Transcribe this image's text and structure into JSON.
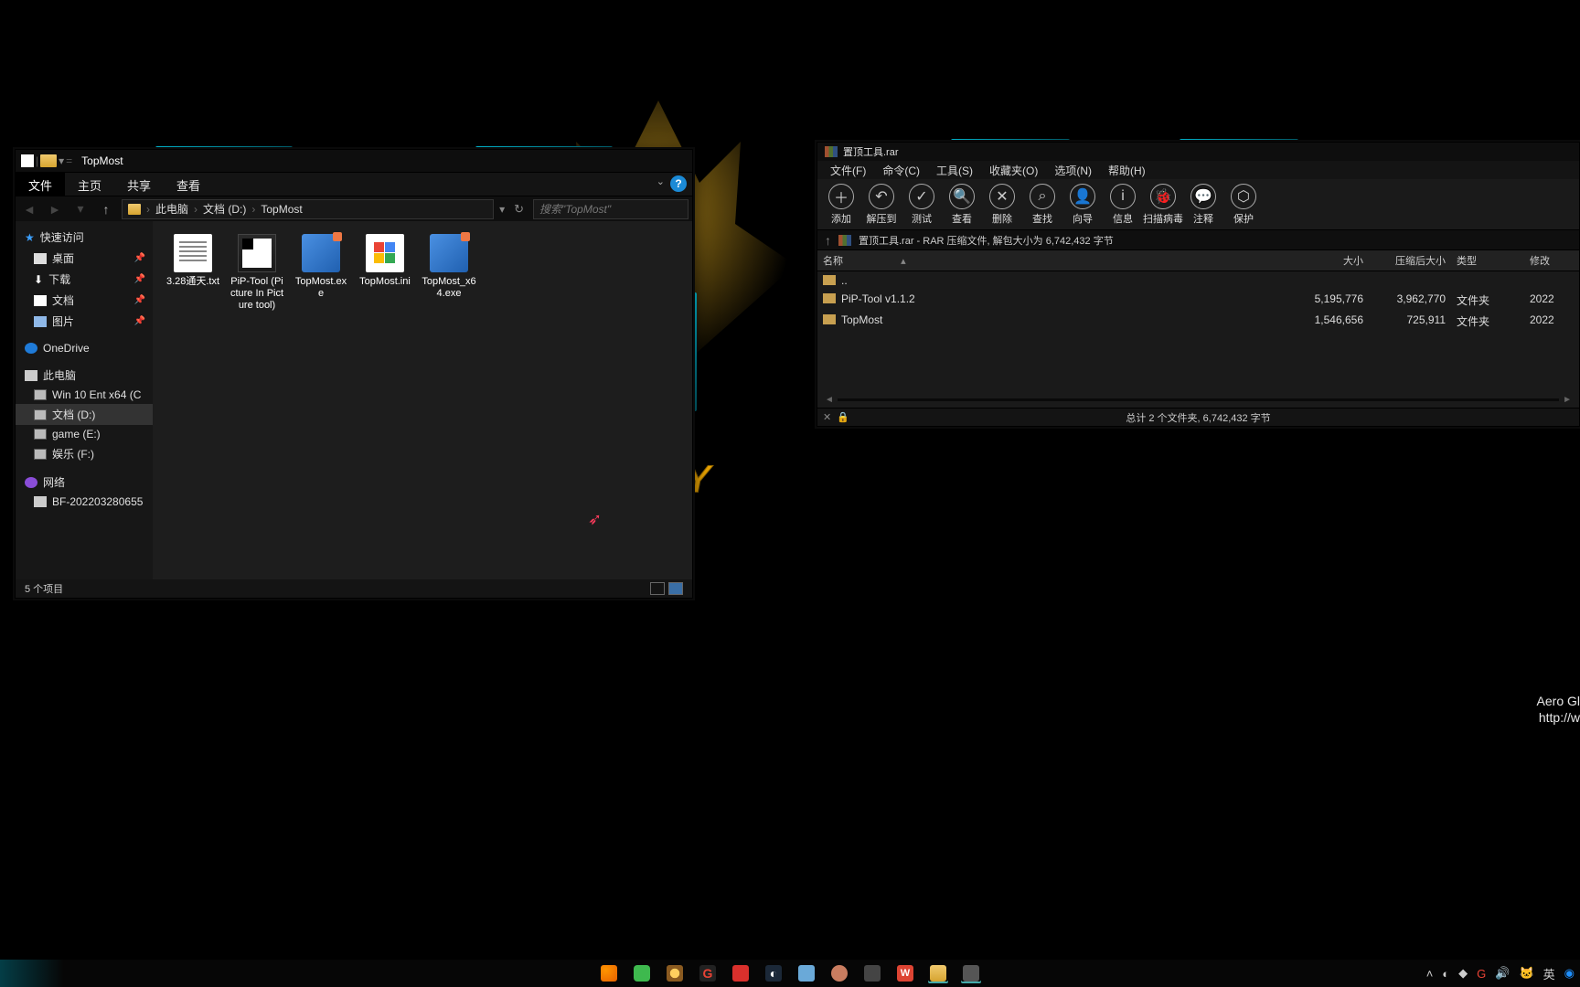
{
  "background": {
    "logo_text": "GLORY"
  },
  "explorer": {
    "title": "TopMost",
    "ribbon": {
      "file": "文件",
      "home": "主页",
      "share": "共享",
      "view": "查看"
    },
    "breadcrumb": [
      "此电脑",
      "文档 (D:)",
      "TopMost"
    ],
    "search_placeholder": "搜索\"TopMost\"",
    "sidebar": {
      "quick": "快速访问",
      "items_quick": [
        {
          "label": "桌面",
          "pinned": true
        },
        {
          "label": "下载",
          "pinned": true
        },
        {
          "label": "文档",
          "pinned": true
        },
        {
          "label": "图片",
          "pinned": true
        }
      ],
      "onedrive": "OneDrive",
      "thispc": "此电脑",
      "drives": [
        {
          "label": "Win 10 Ent x64 (C"
        },
        {
          "label": "文档 (D:)",
          "selected": true
        },
        {
          "label": "game (E:)"
        },
        {
          "label": "娱乐 (F:)"
        }
      ],
      "network": "网络",
      "net_items": [
        {
          "label": "BF-202203280655"
        }
      ]
    },
    "files": [
      {
        "name": "3.28通天.txt",
        "kind": "txt"
      },
      {
        "name": "PiP-Tool (Picture In Picture tool)",
        "kind": "folder"
      },
      {
        "name": "TopMost.exe",
        "kind": "exe"
      },
      {
        "name": "TopMost.ini",
        "kind": "ini"
      },
      {
        "name": "TopMost_x64.exe",
        "kind": "exe"
      }
    ],
    "status": "5 个项目"
  },
  "rar": {
    "title": "置顶工具.rar",
    "menu": [
      "文件(F)",
      "命令(C)",
      "工具(S)",
      "收藏夹(O)",
      "选项(N)",
      "帮助(H)"
    ],
    "tools": [
      "添加",
      "解压到",
      "测试",
      "查看",
      "删除",
      "查找",
      "向导",
      "信息",
      "扫描病毒",
      "注释",
      "保护"
    ],
    "location": "置顶工具.rar - RAR 压缩文件, 解包大小为 6,742,432 字节",
    "columns": {
      "name": "名称",
      "size": "大小",
      "packed": "压缩后大小",
      "type": "类型",
      "modified": "修改"
    },
    "rows": [
      {
        "name": "..",
        "parent": true
      },
      {
        "name": "PiP-Tool v1.1.2",
        "size": "5,195,776",
        "packed": "3,962,770",
        "type": "文件夹",
        "modified": "2022"
      },
      {
        "name": "TopMost",
        "size": "1,546,656",
        "packed": "725,911",
        "type": "文件夹",
        "modified": "2022"
      }
    ],
    "status": "总计 2 个文件夹, 6,742,432 字节"
  },
  "watermark": {
    "line1": "Aero Gl",
    "line2": "http://w"
  },
  "taskbar": {
    "tray": {
      "ime": "英"
    }
  }
}
